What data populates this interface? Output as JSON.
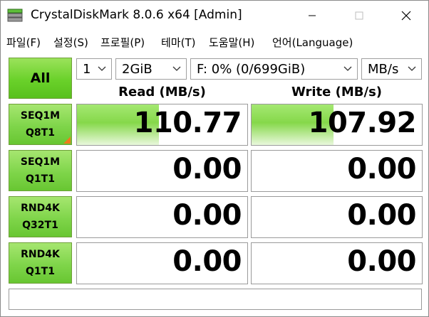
{
  "window": {
    "title": "CrystalDiskMark 8.0.6 x64 [Admin]"
  },
  "menu": [
    "파일(F)",
    "설정(S)",
    "프로필(P)",
    "테마(T)",
    "도움말(H)",
    "언어(Language)"
  ],
  "controls": {
    "all_label": "All",
    "count": "1",
    "size": "2GiB",
    "drive": "F: 0% (0/699GiB)",
    "unit": "MB/s"
  },
  "headers": {
    "read": "Read (MB/s)",
    "write": "Write (MB/s)"
  },
  "tests": [
    {
      "line1": "SEQ1M",
      "line2": "Q8T1",
      "read": "110.77",
      "write": "107.92",
      "read_fill": 0.48,
      "write_fill": 0.48,
      "selected": true
    },
    {
      "line1": "SEQ1M",
      "line2": "Q1T1",
      "read": "0.00",
      "write": "0.00",
      "read_fill": 0,
      "write_fill": 0,
      "selected": false
    },
    {
      "line1": "RND4K",
      "line2": "Q32T1",
      "read": "0.00",
      "write": "0.00",
      "read_fill": 0,
      "write_fill": 0,
      "selected": false
    },
    {
      "line1": "RND4K",
      "line2": "Q1T1",
      "read": "0.00",
      "write": "0.00",
      "read_fill": 0,
      "write_fill": 0,
      "selected": false
    }
  ],
  "status_text": ""
}
